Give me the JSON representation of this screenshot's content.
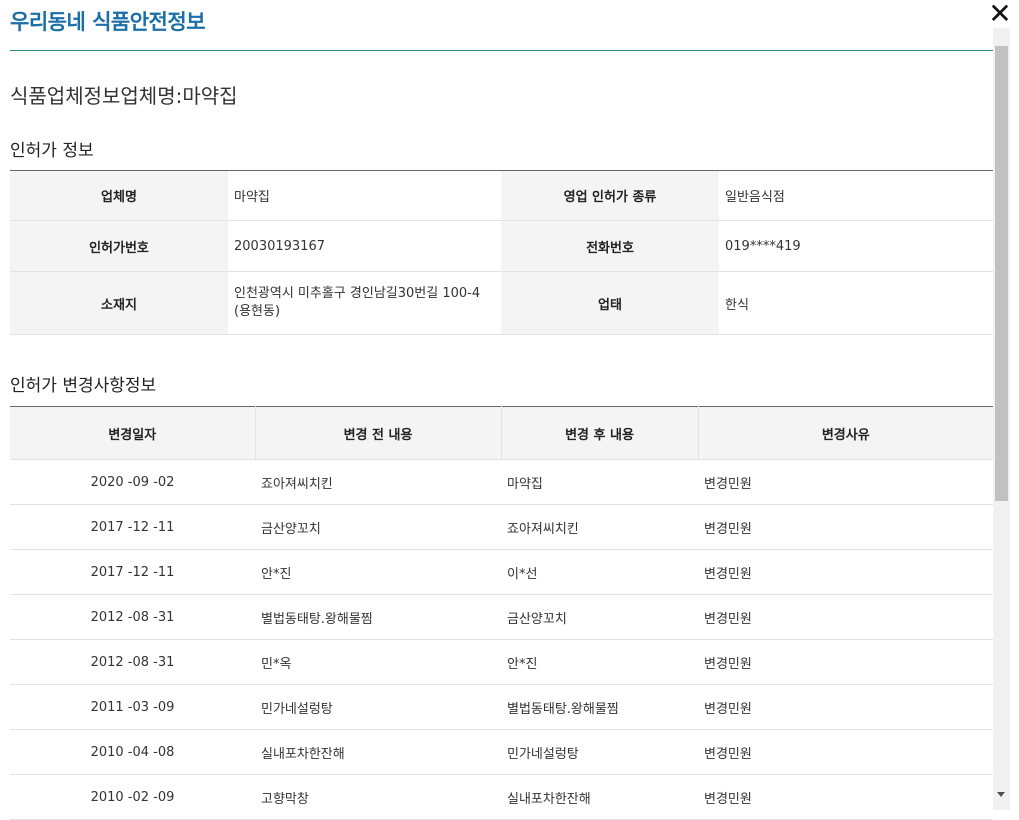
{
  "popup": {
    "title": "우리동네 식품안전정보",
    "close_label": "✕"
  },
  "business_heading": "식품업체정보업체명:마약집",
  "license": {
    "section_title": "인허가 정보",
    "labels": {
      "name": "업체명",
      "license_type": "영업 인허가 종류",
      "license_no": "인허가번호",
      "phone": "전화번호",
      "address": "소재지",
      "category": "업태"
    },
    "values": {
      "name": "마약집",
      "license_type": "일반음식점",
      "license_no": "20030193167",
      "phone": "019****419",
      "address": "인천광역시 미추홀구 경인남길30번길 100-4 (용현동)",
      "category": "한식"
    }
  },
  "changes": {
    "section_title": "인허가 변경사항정보",
    "headers": [
      "변경일자",
      "변경 전 내용",
      "변경 후 내용",
      "변경사유"
    ],
    "rows": [
      {
        "date": "2020 -09 -02",
        "before": "죠아져씨치킨",
        "after": "마약집",
        "reason": "변경민원"
      },
      {
        "date": "2017 -12 -11",
        "before": "금산양꼬치",
        "after": "죠아져씨치킨",
        "reason": "변경민원"
      },
      {
        "date": "2017 -12 -11",
        "before": "안*진",
        "after": "이*선",
        "reason": "변경민원"
      },
      {
        "date": "2012 -08 -31",
        "before": "별법동태탕.왕해물찜",
        "after": "금산양꼬치",
        "reason": "변경민원"
      },
      {
        "date": "2012 -08 -31",
        "before": "민*옥",
        "after": "안*진",
        "reason": "변경민원"
      },
      {
        "date": "2011 -03 -09",
        "before": "민가네설렁탕",
        "after": "별법동태탕.왕해물찜",
        "reason": "변경민원"
      },
      {
        "date": "2010 -04 -08",
        "before": "실내포차한잔해",
        "after": "민가네설렁탕",
        "reason": "변경민원"
      },
      {
        "date": "2010 -02 -09",
        "before": "고향막창",
        "after": "실내포차한잔해",
        "reason": "변경민원"
      }
    ]
  },
  "colors": {
    "title": "#1a6fa8",
    "title_rule": "#2b8a82",
    "header_bg": "#f4f4f4"
  },
  "icons": {
    "close": "close-icon",
    "scroll_down": "chevron-down-icon"
  }
}
